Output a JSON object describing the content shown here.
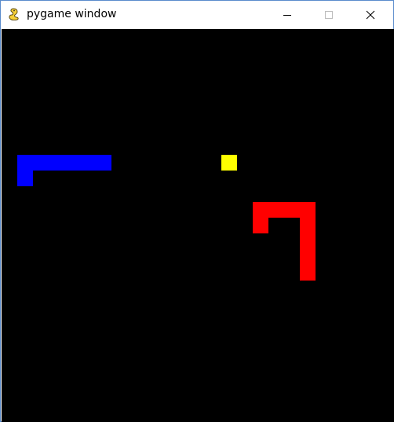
{
  "window": {
    "title": "pygame window",
    "app_icon": "pygame-snake-icon",
    "controls": {
      "minimize_icon": "minimize-icon",
      "maximize_icon": "maximize-icon",
      "close_icon": "close-icon"
    }
  },
  "game": {
    "background_color": "#000000",
    "grid_cell_size": 20,
    "snakes": [
      {
        "name": "blue-snake",
        "color": "#0000ff",
        "cells": [
          [
            1,
            9
          ],
          [
            1,
            8
          ],
          [
            2,
            8
          ],
          [
            3,
            8
          ],
          [
            4,
            8
          ],
          [
            5,
            8
          ],
          [
            6,
            8
          ]
        ]
      },
      {
        "name": "red-snake",
        "color": "#ff0000",
        "cells": [
          [
            16,
            12
          ],
          [
            16,
            11
          ],
          [
            17,
            11
          ],
          [
            18,
            11
          ],
          [
            19,
            11
          ],
          [
            19,
            12
          ],
          [
            19,
            13
          ],
          [
            19,
            14
          ],
          [
            19,
            15
          ]
        ]
      }
    ],
    "food": {
      "color": "#ffff00",
      "cell": [
        14,
        8
      ]
    }
  }
}
